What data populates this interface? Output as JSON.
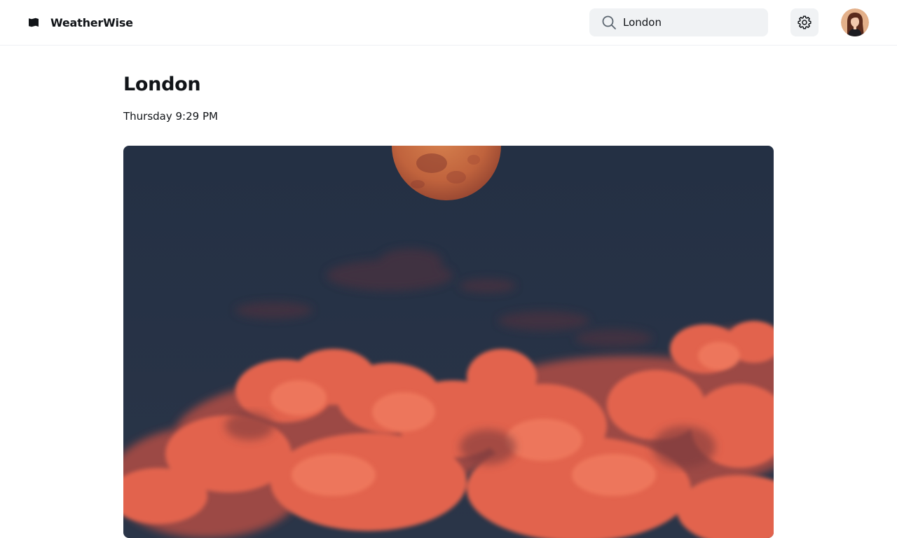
{
  "app": {
    "name": "WeatherWise",
    "logo_icon": "map-flag-icon"
  },
  "search": {
    "value": "London",
    "placeholder": "Search",
    "icon": "search-icon"
  },
  "settings": {
    "icon": "gear-icon"
  },
  "profile": {
    "icon": "avatar"
  },
  "location": {
    "city": "London",
    "datetime": "Thursday 9:29 PM"
  },
  "hero": {
    "scene": "moon-over-clouds"
  },
  "colors": {
    "accent": "#111418",
    "surface": "#f0f2f4",
    "border": "#eef0f3",
    "sky": "#263346",
    "cloud": "#e0624e",
    "moon": "#c8673f"
  }
}
